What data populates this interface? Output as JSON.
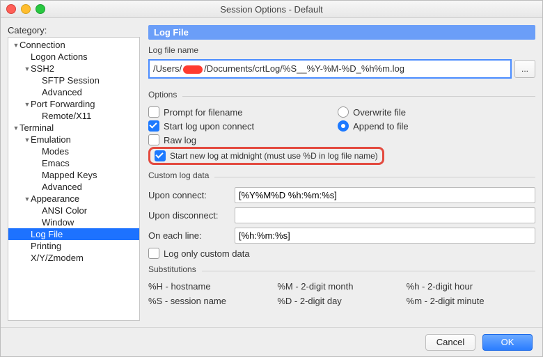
{
  "window": {
    "title": "Session Options - Default"
  },
  "sidebar": {
    "label": "Category:",
    "items": [
      {
        "label": "Connection",
        "indent": 0,
        "tri": "down"
      },
      {
        "label": "Logon Actions",
        "indent": 1
      },
      {
        "label": "SSH2",
        "indent": 1,
        "tri": "down"
      },
      {
        "label": "SFTP Session",
        "indent": 2
      },
      {
        "label": "Advanced",
        "indent": 2
      },
      {
        "label": "Port Forwarding",
        "indent": 1,
        "tri": "down"
      },
      {
        "label": "Remote/X11",
        "indent": 2
      },
      {
        "label": "Terminal",
        "indent": 0,
        "tri": "down"
      },
      {
        "label": "Emulation",
        "indent": 1,
        "tri": "down"
      },
      {
        "label": "Modes",
        "indent": 2
      },
      {
        "label": "Emacs",
        "indent": 2
      },
      {
        "label": "Mapped Keys",
        "indent": 2
      },
      {
        "label": "Advanced",
        "indent": 2
      },
      {
        "label": "Appearance",
        "indent": 1,
        "tri": "down"
      },
      {
        "label": "ANSI Color",
        "indent": 2
      },
      {
        "label": "Window",
        "indent": 2
      },
      {
        "label": "Log File",
        "indent": 1,
        "selected": true
      },
      {
        "label": "Printing",
        "indent": 1
      },
      {
        "label": "X/Y/Zmodem",
        "indent": 1
      }
    ]
  },
  "main": {
    "header": "Log File",
    "logname": {
      "label": "Log file name",
      "value_prefix": "/Users/",
      "value_suffix": "/Documents/crtLog/%S__%Y-%M-%D_%h%m.log",
      "browse": "..."
    },
    "options": {
      "label": "Options",
      "prompt_label": "Prompt for filename",
      "prompt_checked": false,
      "startupon_label": "Start log upon connect",
      "startupon_checked": true,
      "raw_label": "Raw log",
      "raw_checked": false,
      "midnight_label": "Start new log at midnight (must use %D in log file name)",
      "midnight_checked": true,
      "overwrite_label": "Overwrite file",
      "overwrite_checked": false,
      "append_label": "Append to file",
      "append_checked": true
    },
    "custom": {
      "label": "Custom log data",
      "connect_label": "Upon connect:",
      "connect_value": "[%Y%M%D %h:%m:%s]",
      "disconnect_label": "Upon disconnect:",
      "disconnect_value": "",
      "eachline_label": "On each line:",
      "eachline_value": "[%h:%m:%s]",
      "logonly_label": "Log only custom data",
      "logonly_checked": false
    },
    "subs": {
      "label": "Substitutions",
      "H": "%H - hostname",
      "S": "%S - session name",
      "M": "%M - 2-digit month",
      "D": "%D - 2-digit day",
      "hh": "%h - 2-digit hour",
      "mm": "%m - 2-digit minute"
    }
  },
  "footer": {
    "cancel": "Cancel",
    "ok": "OK"
  }
}
